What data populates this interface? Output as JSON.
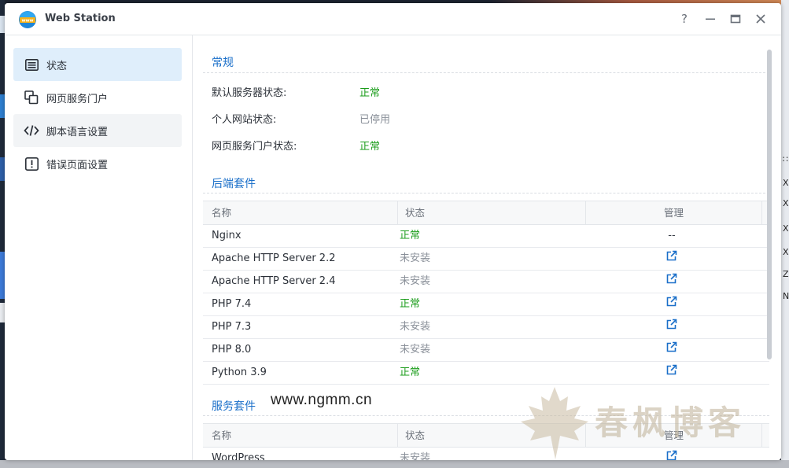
{
  "window": {
    "title": "Web Station"
  },
  "titlebar": {
    "help_icon": "question-mark-icon",
    "minimize_icon": "minimize-icon",
    "maximize_icon": "maximize-icon",
    "close_icon": "close-icon"
  },
  "sidebar": {
    "items": [
      {
        "label": "状态",
        "icon": "list-icon",
        "active": true
      },
      {
        "label": "网页服务门户",
        "icon": "portal-icon",
        "active": false
      },
      {
        "label": "脚本语言设置",
        "icon": "code-icon",
        "active": false
      },
      {
        "label": "错误页面设置",
        "icon": "alert-icon",
        "active": false
      }
    ]
  },
  "general": {
    "title": "常规",
    "rows": [
      {
        "label": "默认服务器状态:",
        "value": "正常",
        "tone": "ok"
      },
      {
        "label": "个人网站状态:",
        "value": "已停用",
        "tone": "grey"
      },
      {
        "label": "网页服务门户状态:",
        "value": "正常",
        "tone": "ok"
      }
    ]
  },
  "backend": {
    "title": "后端套件",
    "headers": [
      "名称",
      "状态",
      "管理"
    ],
    "rows": [
      {
        "name": "Nginx",
        "status": "正常",
        "tone": "ok",
        "manage": "--"
      },
      {
        "name": "Apache HTTP Server 2.2",
        "status": "未安装",
        "tone": "grey",
        "manage": "link"
      },
      {
        "name": "Apache HTTP Server 2.4",
        "status": "未安装",
        "tone": "grey",
        "manage": "link"
      },
      {
        "name": "PHP 7.4",
        "status": "正常",
        "tone": "ok",
        "manage": "link"
      },
      {
        "name": "PHP 7.3",
        "status": "未安装",
        "tone": "grey",
        "manage": "link"
      },
      {
        "name": "PHP 8.0",
        "status": "未安装",
        "tone": "grey",
        "manage": "link"
      },
      {
        "name": "Python 3.9",
        "status": "正常",
        "tone": "ok",
        "manage": "link"
      }
    ]
  },
  "services": {
    "title": "服务套件",
    "headers": [
      "名称",
      "状态",
      "管理"
    ],
    "rows": [
      {
        "name": "WordPress",
        "status": "未安装",
        "tone": "grey",
        "manage": "link"
      }
    ]
  },
  "watermark": {
    "url": "www.ngmm.cn",
    "brand": "春枫博客"
  },
  "colors": {
    "accent": "#1a6fc9",
    "ok": "#1a9c1a",
    "grey": "#8a9099",
    "active_bg": "#dfeefb"
  }
}
